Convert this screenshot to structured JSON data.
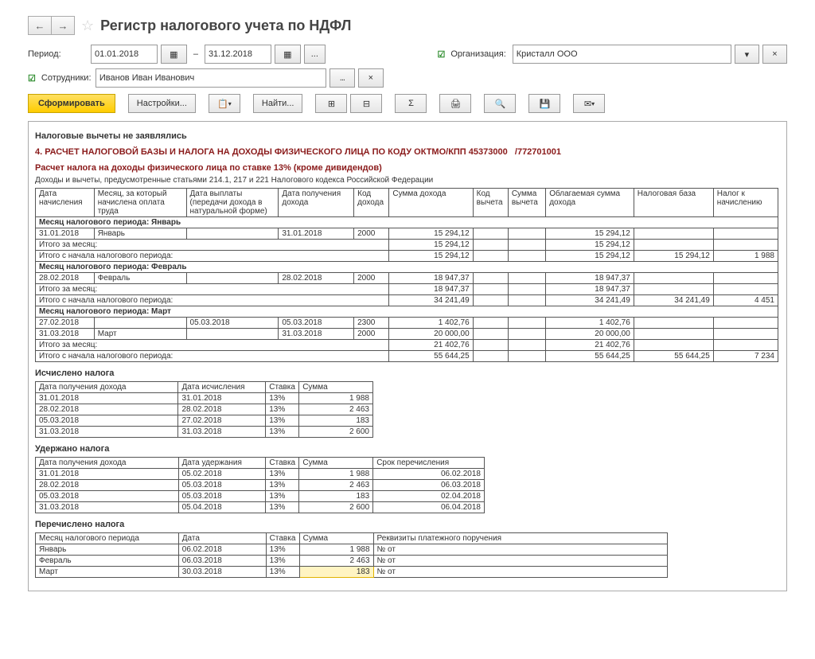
{
  "header": {
    "title": "Регистр налогового учета по НДФЛ"
  },
  "filters": {
    "period_label": "Период:",
    "date_from": "01.01.2018",
    "sep": "–",
    "date_to": "31.12.2018",
    "dots": "...",
    "org_label": "Организация:",
    "org_value": "Кристалл ООО",
    "emp_label": "Сотрудники:",
    "emp_value": "Иванов Иван Иванович",
    "x": "×",
    "dd": "▾"
  },
  "toolbar": {
    "generate": "Сформировать",
    "settings": "Настройки...",
    "find": "Найти..."
  },
  "report": {
    "deduct_note": "Налоговые вычеты не заявлялись",
    "section_title": "4. РАСЧЕТ НАЛОГОВОЙ БАЗЫ И НАЛОГА НА ДОХОДЫ ФИЗИЧЕСКОГО ЛИЦА ПО КОДУ ОКТМО/КПП 45373000",
    "section_kpp": "/772701001",
    "calc_title": "Расчет налога на доходы физического лица по ставке 13% (кроме дивидендов)",
    "note": "Доходы и вычеты, предусмотренные статьями 214.1, 217 и 221 Налогового кодекса Российской Федерации"
  },
  "main_headers": {
    "c1": "Дата начисления",
    "c2": "Месяц, за который начислена оплата труда",
    "c3": "Дата выплаты (передачи дохода в натуральной форме)",
    "c4": "Дата получения дохода",
    "c5": "Код дохода",
    "c6": "Сумма дохода",
    "c7": "Код вычета",
    "c8": "Сумма вычета",
    "c9": "Облагаемая сумма дохода",
    "c10": "Налоговая база",
    "c11": "Налог к начислению"
  },
  "months": {
    "jan_hdr": "Месяц налогового периода: Январь",
    "feb_hdr": "Месяц налогового периода: Февраль",
    "mar_hdr": "Месяц налогового периода: Март",
    "month_jan": "Январь",
    "month_feb": "Февраль",
    "month_mar": "Март",
    "d310118": "31.01.2018",
    "d280218": "28.02.2018",
    "d270218": "27.02.2018",
    "d050318": "05.03.2018",
    "d310318": "31.03.2018",
    "code2000": "2000",
    "code2300": "2300",
    "sum_15294": "15 294,12",
    "sum_18947": "18 947,37",
    "sum_34241": "34 241,49",
    "sum_1402": "1 402,76",
    "sum_20000": "20 000,00",
    "sum_21402": "21 402,76",
    "sum_55644": "55 644,25",
    "tax_1988": "1 988",
    "tax_4451": "4 451",
    "tax_7234": "7 234",
    "itogo_month": "Итого за месяц:",
    "itogo_start": "Итого с начала налогового периода:"
  },
  "calc_tax": {
    "title": "Исчислено налога",
    "h1": "Дата получения дохода",
    "h2": "Дата исчисления",
    "h3": "Ставка",
    "h4": "Сумма",
    "r1_d1": "31.01.2018",
    "r1_d2": "31.01.2018",
    "r1_rate": "13%",
    "r1_sum": "1 988",
    "r2_d1": "28.02.2018",
    "r2_d2": "28.02.2018",
    "r2_rate": "13%",
    "r2_sum": "2 463",
    "r3_d1": "05.03.2018",
    "r3_d2": "27.02.2018",
    "r3_rate": "13%",
    "r3_sum": "183",
    "r4_d1": "31.03.2018",
    "r4_d2": "31.03.2018",
    "r4_rate": "13%",
    "r4_sum": "2 600"
  },
  "withheld": {
    "title": "Удержано налога",
    "h1": "Дата получения дохода",
    "h2": "Дата удержания",
    "h3": "Ставка",
    "h4": "Сумма",
    "h5": "Срок перечисления",
    "r1_d1": "31.01.2018",
    "r1_d2": "05.02.2018",
    "r1_rate": "13%",
    "r1_sum": "1 988",
    "r1_due": "06.02.2018",
    "r2_d1": "28.02.2018",
    "r2_d2": "05.03.2018",
    "r2_rate": "13%",
    "r2_sum": "2 463",
    "r2_due": "06.03.2018",
    "r3_d1": "05.03.2018",
    "r3_d2": "05.03.2018",
    "r3_rate": "13%",
    "r3_sum": "183",
    "r3_due": "02.04.2018",
    "r4_d1": "31.03.2018",
    "r4_d2": "05.04.2018",
    "r4_rate": "13%",
    "r4_sum": "2 600",
    "r4_due": "06.04.2018"
  },
  "transferred": {
    "title": "Перечислено налога",
    "h1": "Месяц налогового периода",
    "h2": "Дата",
    "h3": "Ставка",
    "h4": "Сумма",
    "h5": "Реквизиты платежного поручения",
    "r1_m": "Январь",
    "r1_d": "06.02.2018",
    "r1_rate": "13%",
    "r1_sum": "1 988",
    "r1_req": "№  от",
    "r2_m": "Февраль",
    "r2_d": "06.03.2018",
    "r2_rate": "13%",
    "r2_sum": "2 463",
    "r2_req": "№  от",
    "r3_m": "Март",
    "r3_d": "30.03.2018",
    "r3_rate": "13%",
    "r3_sum": "183",
    "r3_req": "№  от"
  }
}
